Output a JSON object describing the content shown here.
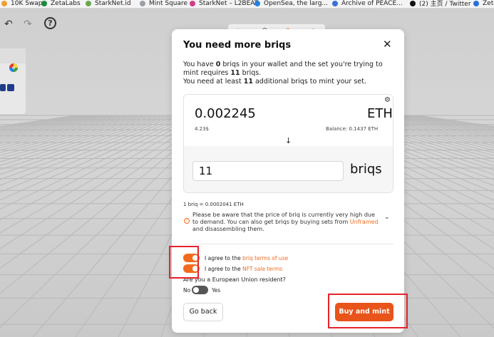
{
  "bookmarks": [
    {
      "label": "10K Swap",
      "color": "#f0a030"
    },
    {
      "label": "ZetaLabs",
      "color": "#1e8a3a"
    },
    {
      "label": "StarkNet.id",
      "color": "#6aa84f"
    },
    {
      "label": "Mint Square",
      "color": "#9aa0a6"
    },
    {
      "label": "StarkNet – L2BEAT",
      "color": "#d23b8a"
    },
    {
      "label": "OpenSea, the larg...",
      "color": "#2081e2"
    },
    {
      "label": "Archive of PEACE...",
      "color": "#3a6fd8"
    },
    {
      "label": "(2) 主页 / Twitter",
      "color": "#111111"
    },
    {
      "label": "Zeta",
      "color": "#2a6fdb"
    }
  ],
  "toolbar": {
    "tools": [
      "pointer-icon",
      "cube-icon",
      "brush-icon",
      "eraser-icon"
    ]
  },
  "modal": {
    "title": "You need more briqs",
    "intro_1": "You have ",
    "have": "0",
    "intro_2": " briqs in your wallet and the set you're trying to mint requires ",
    "required": "11",
    "intro_3": " briqs.",
    "intro_4": "You need at least ",
    "need": "11",
    "intro_5": " additional briqs to mint your set.",
    "price": "0.002245",
    "currency": "ETH",
    "usd": "4.23$",
    "balance": "Balance: 0.1437 ETH",
    "quantity": "11",
    "unit": "briqs",
    "rate": "1 briq = 0.0002041 ETH",
    "warning": "Please be aware that the price of briq is currently very high due to demand. You can also get briqs by buying sets from ",
    "warning_link": "Unframed",
    "warning_end": " and disassembling them.",
    "agree_prefix": "I agree to the ",
    "briq_terms": "briq terms of use",
    "nft_terms": "NFT sale terms",
    "eu_question": "Are you a European Union resident?",
    "no": "No",
    "yes": "Yes",
    "back": "Go back",
    "mint": "Buy and mint"
  },
  "colors": {
    "accent": "#f26b1d",
    "mint_button": "#e9541a",
    "highlight": "#e8222a"
  }
}
